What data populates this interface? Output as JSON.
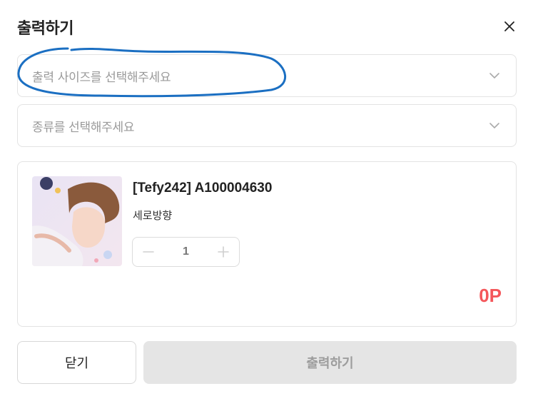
{
  "dialog": {
    "title": "출력하기",
    "close_icon": "close-icon"
  },
  "size_select": {
    "placeholder": "출력 사이즈를 선택해주세요",
    "icon": "chevron-down-icon"
  },
  "type_select": {
    "placeholder": "종류를 선택해주세요",
    "icon": "chevron-down-icon"
  },
  "product": {
    "name": "[Tefy242] A100004630",
    "orientation": "세로방향",
    "quantity": "1",
    "price": "0P",
    "minus_icon": "minus-icon",
    "plus_icon": "plus-icon"
  },
  "buttons": {
    "close_label": "닫기",
    "print_label": "출력하기"
  },
  "colors": {
    "price": "#f4575b",
    "annotation": "#1b6fc2",
    "disabled_button": "#e5e5e5"
  }
}
